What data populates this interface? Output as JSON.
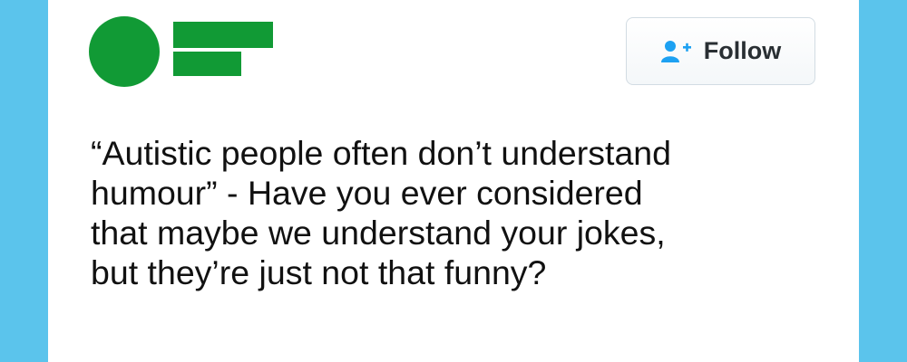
{
  "colors": {
    "background": "#5bc4ec",
    "card": "#ffffff",
    "avatar_green": "#119a35",
    "follow_icon": "#1da1f2",
    "text": "#111111"
  },
  "header": {
    "avatar_icon": "green-circle-and-bars-logo",
    "follow_button": {
      "icon": "add-user-icon",
      "label": "Follow"
    }
  },
  "tweet": {
    "text": "“Autistic people often don’t understand\nhumour” - Have you ever considered\nthat maybe we understand your jokes,\nbut they’re just not that funny?"
  }
}
